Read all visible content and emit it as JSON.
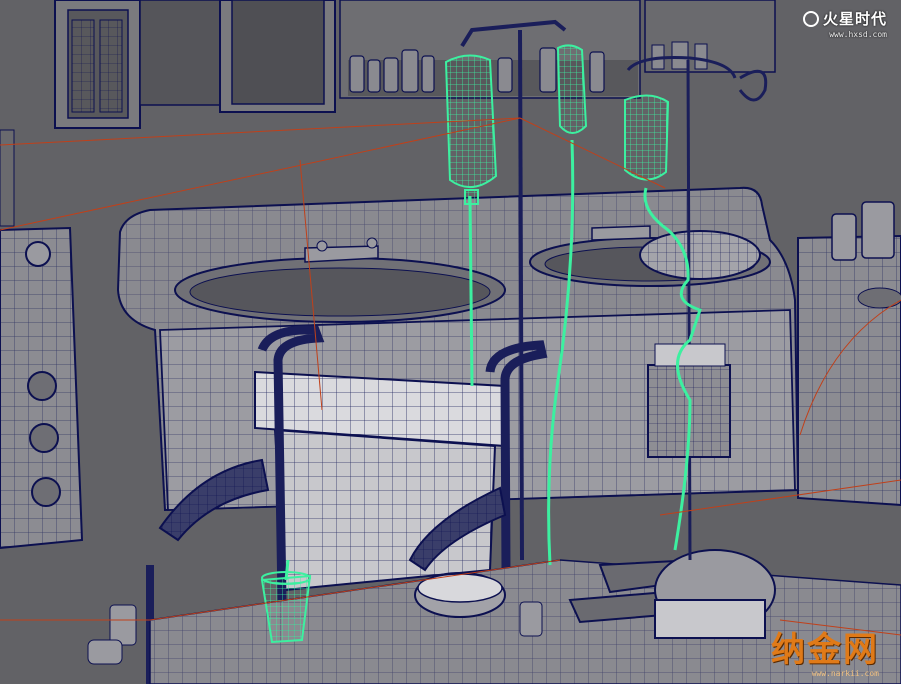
{
  "scene": {
    "description_type": "wireframe-render",
    "colors": {
      "background": "#5e5e62",
      "wall": "#6a6a6e",
      "surface_light": "#d8d8dc",
      "surface_mid": "#9a9aa0",
      "wire_dark": "#0c1050",
      "wire_selected": "#3cf0a0",
      "guide_red": "#c0401a",
      "brand_orange": "#e07a18"
    }
  },
  "watermarks": {
    "top_logo_text": "火星时代",
    "top_logo_url": "www.hxsd.com",
    "bottom_brand_text": "纳金网",
    "bottom_brand_url": "www.narkii.com"
  }
}
